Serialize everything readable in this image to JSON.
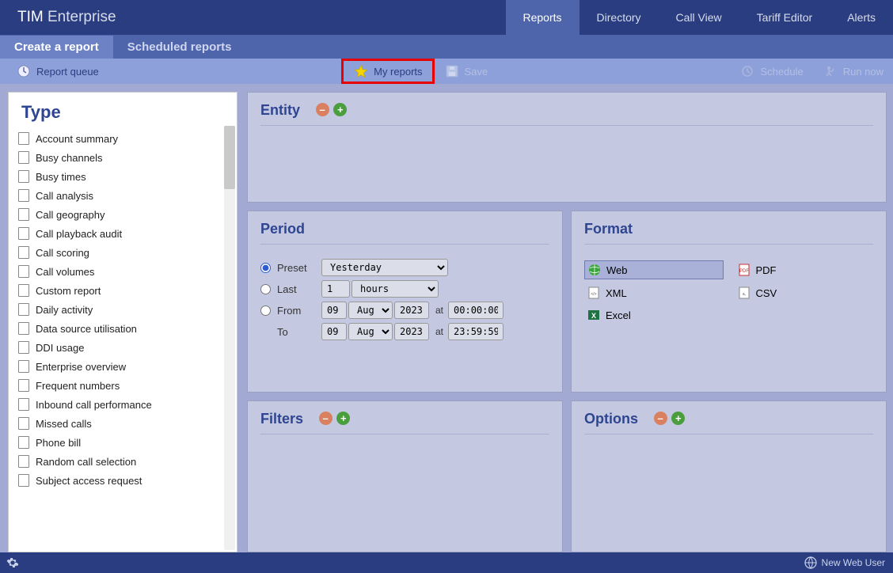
{
  "logo": {
    "bold": "TIM",
    "light": " Enterprise"
  },
  "main_nav": [
    "Reports",
    "Directory",
    "Call View",
    "Tariff Editor",
    "Alerts"
  ],
  "main_nav_active": 0,
  "subtabs": [
    "Create a report",
    "Scheduled reports"
  ],
  "subtabs_active": 0,
  "toolbar": {
    "queue": "Report queue",
    "my_reports": "My reports",
    "save": "Save",
    "schedule": "Schedule",
    "run_now": "Run now"
  },
  "sidebar": {
    "heading": "Type",
    "items": [
      "Account summary",
      "Busy channels",
      "Busy times",
      "Call analysis",
      "Call geography",
      "Call playback audit",
      "Call scoring",
      "Call volumes",
      "Custom report",
      "Daily activity",
      "Data source utilisation",
      "DDI usage",
      "Enterprise overview",
      "Frequent numbers",
      "Inbound call performance",
      "Missed calls",
      "Phone bill",
      "Random call selection",
      "Subject access request"
    ]
  },
  "entity": {
    "heading": "Entity"
  },
  "period": {
    "heading": "Period",
    "preset_label": "Preset",
    "preset_value": "Yesterday",
    "last_label": "Last",
    "last_value": "1",
    "last_unit": "hours",
    "from_label": "From",
    "to_label": "To",
    "at_label": "at",
    "from_day": "09",
    "from_month": "Aug",
    "from_year": "2023",
    "from_time": "00:00:00",
    "to_day": "09",
    "to_month": "Aug",
    "to_year": "2023",
    "to_time": "23:59:59"
  },
  "format": {
    "heading": "Format",
    "web": "Web",
    "pdf": "PDF",
    "xml": "XML",
    "csv": "CSV",
    "excel": "Excel"
  },
  "filters": {
    "heading": "Filters"
  },
  "options": {
    "heading": "Options"
  },
  "status": {
    "user": "New Web User"
  }
}
